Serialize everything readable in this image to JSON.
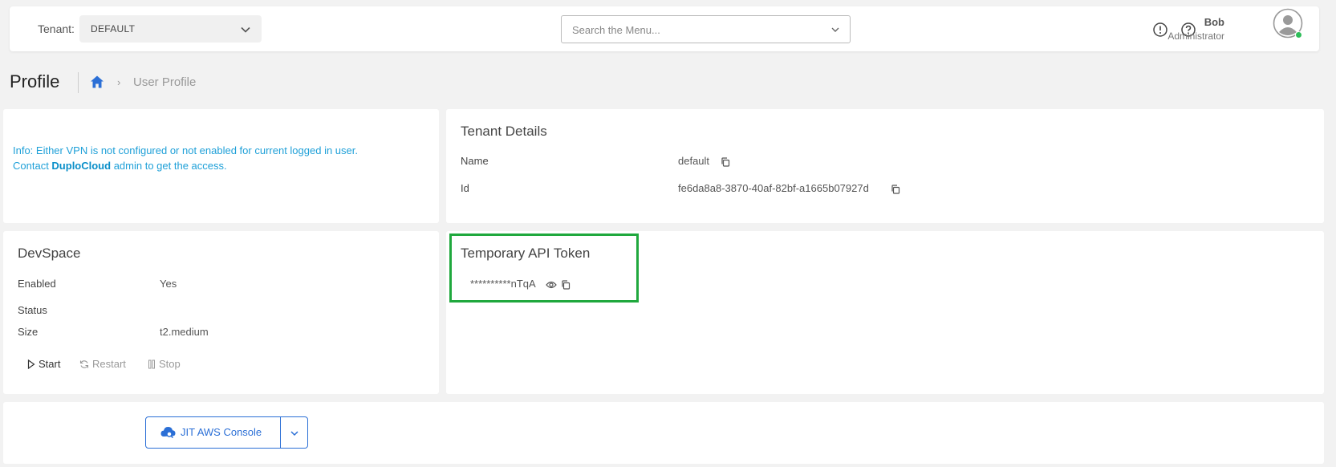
{
  "header": {
    "tenant_label": "Tenant:",
    "tenant_value": "DEFAULT",
    "search_placeholder": "Search the Menu...",
    "user_name": "Bob",
    "user_role": "Administrator"
  },
  "breadcrumb": {
    "title": "Profile",
    "separator": "›",
    "current": "User Profile"
  },
  "info": {
    "line1": "Info: Either VPN is not configured or not enabled for current logged in user.",
    "line2_prefix": "Contact ",
    "line2_brand": "DuploCloud",
    "line2_suffix": " admin to get the access."
  },
  "tenant_details": {
    "title": "Tenant Details",
    "name_label": "Name",
    "name_value": "default",
    "id_label": "Id",
    "id_value": "fe6da8a8-3870-40af-82bf-a1665b07927d"
  },
  "devspace": {
    "title": "DevSpace",
    "enabled_label": "Enabled",
    "enabled_value": "Yes",
    "status_label": "Status",
    "size_label": "Size",
    "size_value": "t2.medium",
    "start_label": "Start",
    "restart_label": "Restart",
    "stop_label": "Stop"
  },
  "api_token": {
    "title": "Temporary API Token",
    "masked_value": "**********nTqA"
  },
  "jit": {
    "button_label": "JIT AWS Console"
  },
  "colors": {
    "accent": "#2b6fd6",
    "info": "#1fa0d8",
    "highlight": "#1fa83d",
    "status_online": "#2ebd59"
  }
}
